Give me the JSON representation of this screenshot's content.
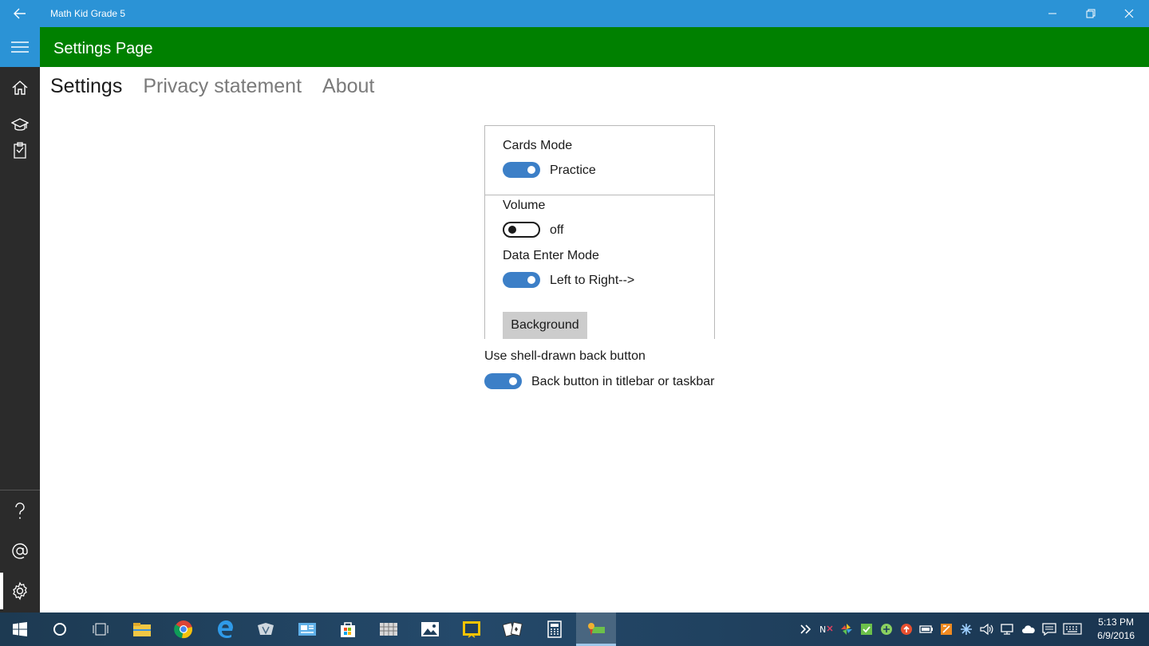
{
  "titlebar": {
    "title": "Math Kid Grade 5",
    "color": "#2b93d6"
  },
  "header": {
    "title": "Settings Page",
    "color": "#008000"
  },
  "nav": {
    "items": [
      {
        "icon": "hamburger-icon"
      },
      {
        "icon": "home-icon"
      },
      {
        "icon": "graduation-cap-icon"
      },
      {
        "icon": "clipboard-icon"
      },
      {
        "icon": "help-icon"
      },
      {
        "icon": "at-sign-icon"
      },
      {
        "icon": "gear-icon",
        "selected": true
      }
    ]
  },
  "tabs": [
    {
      "label": "Settings",
      "active": true
    },
    {
      "label": "Privacy statement",
      "active": false
    },
    {
      "label": "About",
      "active": false
    }
  ],
  "settings": {
    "cards_mode": {
      "label": "Cards Mode",
      "state": "Practice",
      "on": true
    },
    "volume": {
      "label": "Volume",
      "state": "off",
      "on": false
    },
    "data_enter_mode": {
      "label": "Data Enter Mode",
      "state": "Left to Right-->",
      "on": true
    },
    "background_button": "Background",
    "shell_back": {
      "label": "Use shell-drawn back button",
      "state": "Back button in titlebar or taskbar",
      "on": true
    }
  },
  "accent_color": "#3c7fc7",
  "taskbar": {
    "apps": [
      "windows-start-icon",
      "cortana-icon",
      "task-view-icon",
      "file-explorer-icon",
      "chrome-icon",
      "edge-icon",
      "app-icon",
      "app-icon",
      "store-icon",
      "app-icon",
      "photos-icon",
      "app-icon",
      "solitaire-icon",
      "calculator-icon",
      "math-kid-icon"
    ],
    "clock_time": "5:13 PM",
    "clock_date": "6/9/2016"
  }
}
